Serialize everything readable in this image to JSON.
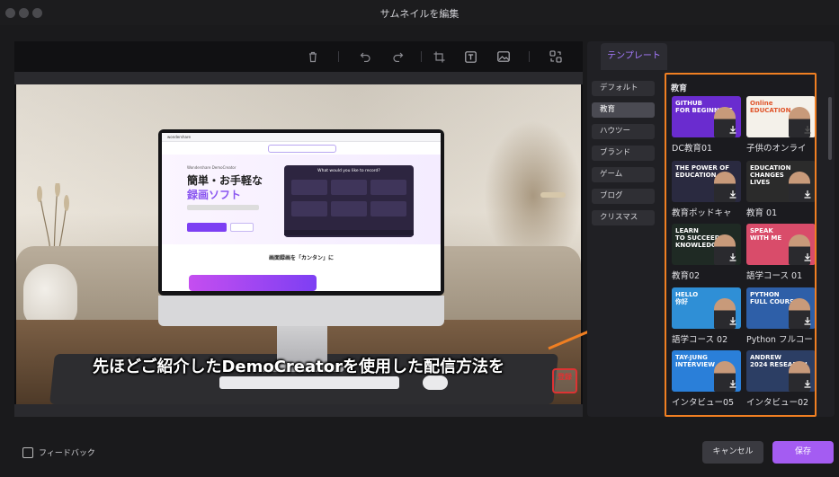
{
  "window": {
    "title": "サムネイルを編集"
  },
  "toolbar": {
    "tools": [
      {
        "icon": "trash-icon"
      },
      {
        "icon": "undo-icon"
      },
      {
        "icon": "redo-icon"
      },
      {
        "icon": "crop-icon"
      },
      {
        "icon": "text-icon"
      },
      {
        "icon": "image-icon"
      },
      {
        "icon": "replace-icon"
      }
    ]
  },
  "preview": {
    "caption": "先ほどご紹介したDemoCreatorを使用した配信方法を",
    "screen": {
      "logo": "wondershare",
      "kicker": "Wondershare DemoCreator",
      "heading1": "簡単・お手軽な",
      "heading2": "録画ソフト",
      "record_title": "What would you like to record?",
      "subheading": "画面録画を「カンタン」に"
    },
    "subscribe_badge": "登録"
  },
  "panel": {
    "tab_label": "テンプレート",
    "categories": [
      "デフォルト",
      "教育",
      "ハウツー",
      "ブランド",
      "ゲーム",
      "ブログ",
      "クリスマス"
    ],
    "selected_category": "教育",
    "section_title": "教育",
    "templates": [
      {
        "label": "DC教育01",
        "thumb_text": "GITHUB\nFOR BEGINNERS",
        "bg": "#6a2ccf"
      },
      {
        "label": "子供のオンライ",
        "thumb_text": "Online\nEDUCATION",
        "bg": "#f4f1ea"
      },
      {
        "label": "教育ポッドキャ",
        "thumb_text": "THE POWER OF\nEDUCATION",
        "bg": "#2a2a40"
      },
      {
        "label": "教育 01",
        "thumb_text": "EDUCATION\nCHANGES\nLIVES",
        "bg": "#2b2b2b"
      },
      {
        "label": "教育02",
        "thumb_text": "LEARN\nTO SUCCEED\nKNOWLEDGE",
        "bg": "#1f2a24"
      },
      {
        "label": "語学コース 01",
        "thumb_text": "SPEAK\nWITH ME",
        "bg": "#d94c6a"
      },
      {
        "label": "語学コース 02",
        "thumb_text": "HELLO\n你好",
        "bg": "#2f8fd6"
      },
      {
        "label": "Python フルコー",
        "thumb_text": "PYTHON\nFULL COURSE",
        "bg": "#2e5fa8"
      },
      {
        "label": "インタビュー05",
        "thumb_text": "TAY-JUNG\nINTERVIEW",
        "bg": "#2a7fd9"
      },
      {
        "label": "インタビュー02",
        "thumb_text": "ANDREW\n2024 RESEARCH",
        "bg": "#2c3e64"
      }
    ]
  },
  "footer": {
    "feedback_label": "フィードバック",
    "cancel_label": "キャンセル",
    "save_label": "保存"
  },
  "colors": {
    "accent": "#a45cf2",
    "highlight_border": "#f07f22",
    "arrow": "#f07f22"
  }
}
